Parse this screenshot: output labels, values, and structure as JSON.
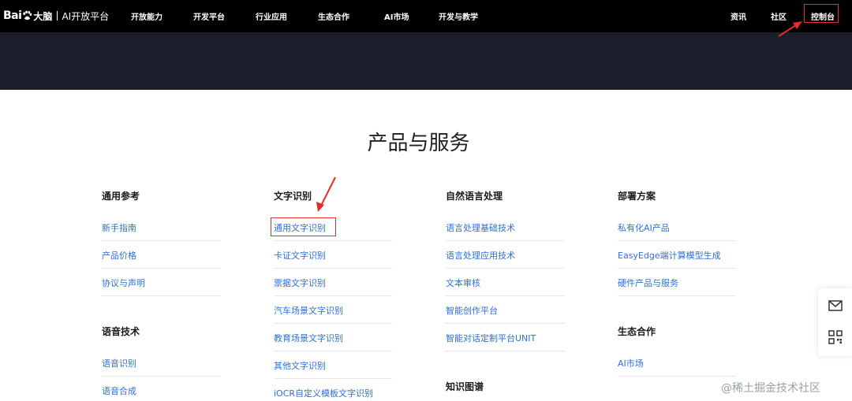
{
  "brand": {
    "logo_text": "Bai",
    "logo_du": "大脑",
    "platform": "AI开放平台"
  },
  "nav": {
    "items": [
      "开放能力",
      "开发平台",
      "行业应用",
      "生态合作",
      "AI市场",
      "开发与教学"
    ],
    "right": {
      "news": "资讯",
      "community": "社区",
      "console": "控制台"
    }
  },
  "main": {
    "title": "产品与服务",
    "columns": [
      {
        "title": "通用参考",
        "links": [
          "新手指南",
          "产品价格",
          "协议与声明"
        ]
      },
      {
        "title": "文字识别",
        "links": [
          "通用文字识别",
          "卡证文字识别",
          "票据文字识别",
          "汽车场景文字识别",
          "教育场景文字识别",
          "其他文字识别",
          "iOCR自定义模板文字识别"
        ]
      },
      {
        "title": "自然语言处理",
        "links": [
          "语言处理基础技术",
          "语言处理应用技术",
          "文本审核",
          "智能创作平台",
          "智能对话定制平台UNIT"
        ]
      },
      {
        "title": "部署方案",
        "links": [
          "私有化AI产品",
          "EasyEdge端计算模型生成",
          "硬件产品与服务"
        ]
      }
    ],
    "sections2": [
      {
        "title": "语音技术",
        "links": [
          "语音识别",
          "语音合成"
        ]
      },
      {
        "title": "知识图谱"
      },
      {
        "title": "生态合作",
        "links": [
          "AI市场"
        ]
      }
    ]
  },
  "side": {
    "icons": [
      "mail-icon",
      "qrcode-icon"
    ]
  },
  "watermark": "@稀土掘金技术社区",
  "colors": {
    "link": "#2f6fd6",
    "highlight": "#e12c2c",
    "topbar": "#000000",
    "banner": "#1b1d2b"
  }
}
